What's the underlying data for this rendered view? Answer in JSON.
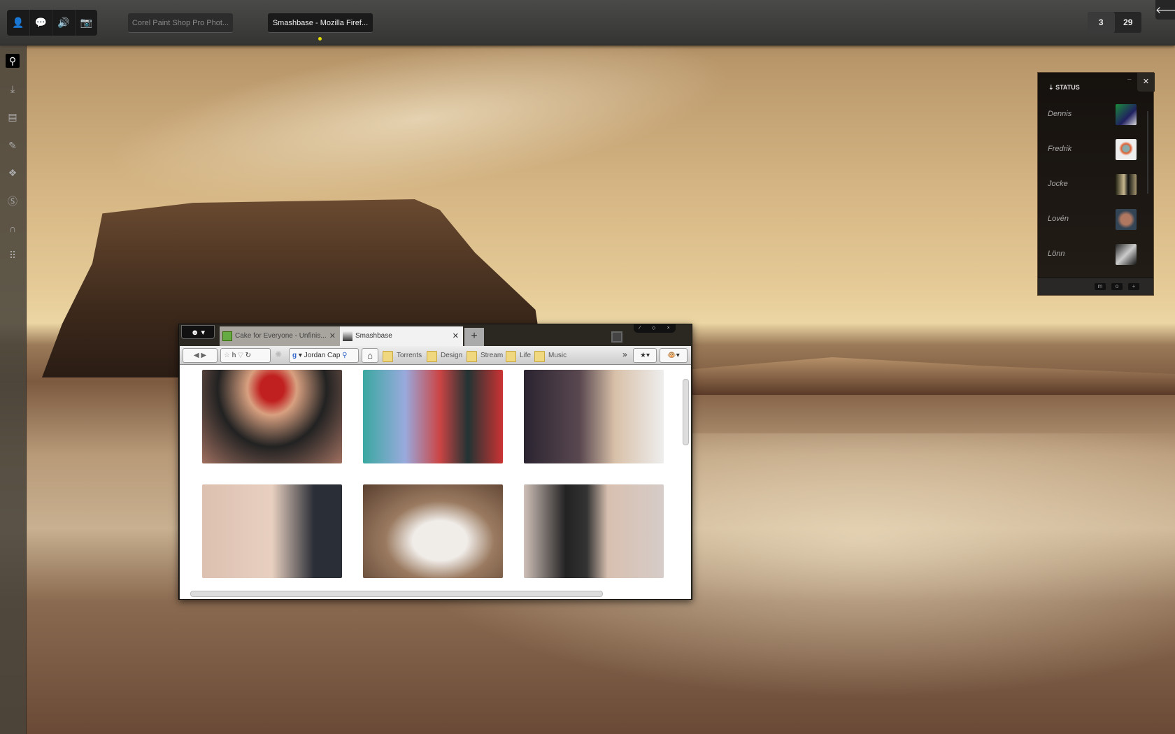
{
  "taskbar": {
    "quick_icons": [
      "user-icon",
      "chat-icon",
      "volume-icon",
      "camera-icon"
    ],
    "tasks": [
      {
        "label": "Corel Paint Shop Pro Phot...",
        "active": false
      },
      {
        "label": "Smashbase - Mozilla Firef...",
        "active": true
      }
    ],
    "counter": {
      "first": "3",
      "second": "29"
    },
    "back_icon": "🡐"
  },
  "sidebar": {
    "icons": [
      "search-icon",
      "download-icon",
      "news-icon",
      "compose-icon",
      "dropbox-icon",
      "skype-icon",
      "headphones-icon",
      "apps-grid-icon"
    ]
  },
  "status_panel": {
    "title": "STATUS",
    "arrow": "⇣",
    "minimize": "–",
    "close": "✕",
    "contacts": [
      {
        "name": "Dennis"
      },
      {
        "name": "Fredrik"
      },
      {
        "name": "Jocke"
      },
      {
        "name": "Lovén"
      },
      {
        "name": "Lönn"
      }
    ],
    "footer_buttons": [
      "m",
      "o",
      "+"
    ]
  },
  "browser": {
    "menu_label": "☻ ▾",
    "tabs": [
      {
        "title": "Cake for Everyone - Unfinis...",
        "close": "✕"
      },
      {
        "title": "Smashbase",
        "close": "✕"
      }
    ],
    "new_tab": "+",
    "window_controls": [
      "⁄",
      "◇",
      "×"
    ],
    "address_value": "h",
    "search_value": "Jordan Cap",
    "bookmarks": [
      "Torrents",
      "Design",
      "Stream",
      "Life",
      "Music"
    ],
    "overflow": "»"
  }
}
